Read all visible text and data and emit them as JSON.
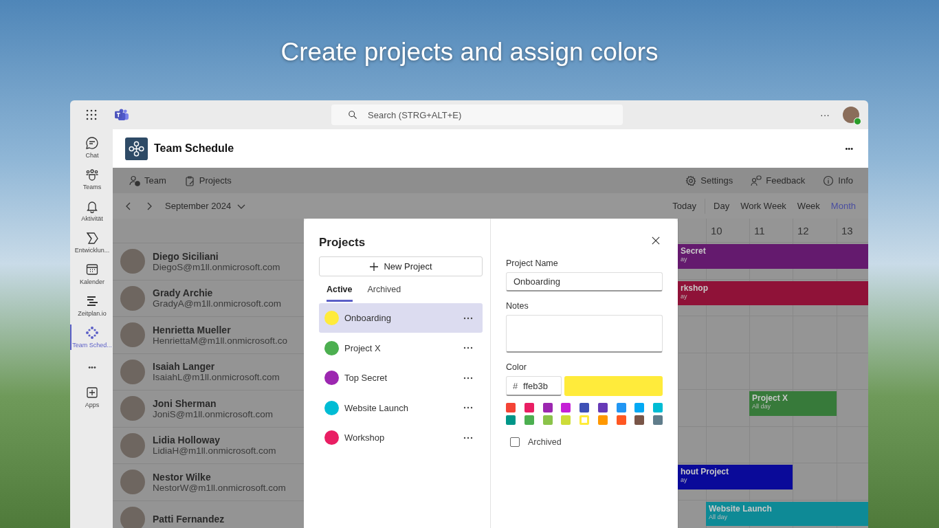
{
  "headline": "Create projects and assign colors",
  "top_bar": {
    "search": {
      "placeholder": "Search (STRG+ALT+E)"
    },
    "more": "···"
  },
  "rail": [
    {
      "label": "Chat",
      "kind": "chat",
      "selected": false
    },
    {
      "label": "Teams",
      "kind": "teams",
      "selected": false
    },
    {
      "label": "Aktivität",
      "kind": "bell",
      "selected": false
    },
    {
      "label": "Entwicklun...",
      "kind": "dev",
      "selected": false
    },
    {
      "label": "Kalender",
      "kind": "calendar",
      "selected": false
    },
    {
      "label": "Zeitplan.io",
      "kind": "lines",
      "selected": false
    },
    {
      "label": "Team Sched...",
      "kind": "app",
      "selected": true
    },
    {
      "label": "•••",
      "kind": "more",
      "selected": false
    },
    {
      "label": "Apps",
      "kind": "apps",
      "selected": false
    }
  ],
  "app_header": {
    "title": "Team Schedule",
    "more": "•••"
  },
  "toolbar": {
    "left": [
      {
        "label": "Team",
        "kind": "team"
      },
      {
        "label": "Projects",
        "kind": "projects"
      }
    ],
    "right": [
      {
        "label": "Settings",
        "kind": "settings"
      },
      {
        "label": "Feedback",
        "kind": "feedback"
      },
      {
        "label": "Info",
        "kind": "info"
      }
    ]
  },
  "nav": {
    "month": "September 2024",
    "today": "Today",
    "views": [
      {
        "label": "Day",
        "selected": false
      },
      {
        "label": "Work Week",
        "selected": false
      },
      {
        "label": "Week",
        "selected": false
      },
      {
        "label": "Month",
        "selected": true
      }
    ]
  },
  "people": [
    {
      "name": "Diego Siciliani",
      "email": "DiegoS@m1ll.onmicrosoft.com"
    },
    {
      "name": "Grady Archie",
      "email": "GradyA@m1ll.onmicrosoft.com"
    },
    {
      "name": "Henrietta Mueller",
      "email": "HenriettaM@m1ll.onmicrosoft.co"
    },
    {
      "name": "Isaiah Langer",
      "email": "IsaiahL@m1ll.onmicrosoft.com"
    },
    {
      "name": "Joni Sherman",
      "email": "JoniS@m1ll.onmicrosoft.com"
    },
    {
      "name": "Lidia Holloway",
      "email": "LidiaH@m1ll.onmicrosoft.com"
    },
    {
      "name": "Nestor Wilke",
      "email": "NestorW@m1ll.onmicrosoft.com"
    },
    {
      "name": "Patti Fernandez"
    }
  ],
  "calendar": {
    "days": [
      "10",
      "11",
      "12",
      "13"
    ],
    "rows": [
      {
        "event": {
          "title": "Secret",
          "subtitle": "ay",
          "color": "#641a6e"
        }
      },
      {
        "event": {
          "title": "rkshop",
          "subtitle": "ay",
          "color": "#8f1238"
        }
      },
      {},
      {},
      {
        "event": {
          "title": "Project X",
          "subtitle": "All day",
          "color": "#377a3a"
        }
      },
      {},
      {
        "event": {
          "title": "hout Project",
          "subtitle": "ay",
          "color": "#0a0a99"
        }
      },
      {
        "event": {
          "title": "Website Launch",
          "subtitle": "All day",
          "color": "#0e8a96"
        }
      }
    ]
  },
  "dialog": {
    "title": "Projects",
    "new_button": "New Project",
    "tabs": [
      {
        "label": "Active",
        "selected": true
      },
      {
        "label": "Archived",
        "selected": false
      }
    ],
    "projects": [
      {
        "name": "Onboarding",
        "color": "#ffeb3b",
        "selected": true
      },
      {
        "name": "Project X",
        "color": "#4caf50",
        "selected": false
      },
      {
        "name": "Top Secret",
        "color": "#9c27b0",
        "selected": false
      },
      {
        "name": "Website Launch",
        "color": "#00bcd4",
        "selected": false
      },
      {
        "name": "Workshop",
        "color": "#e91e63",
        "selected": false
      }
    ],
    "name_label": "Project Name",
    "name_value": "Onboarding",
    "notes_label": "Notes",
    "color_label": "Color",
    "hex_prefix": "#",
    "hex_value": "ffeb3b",
    "palette": [
      {
        "color": "#f44336",
        "selected": false
      },
      {
        "color": "#e91e63",
        "selected": false
      },
      {
        "color": "#9c27b0",
        "selected": false
      },
      {
        "color": "#c51fd6",
        "selected": false
      },
      {
        "color": "#3f51b5",
        "selected": false
      },
      {
        "color": "#673ab7",
        "selected": false
      },
      {
        "color": "#2196f3",
        "selected": false
      },
      {
        "color": "#03a9f4",
        "selected": false
      },
      {
        "color": "#00bcd4",
        "selected": false
      },
      {
        "color": "#009688",
        "selected": false
      },
      {
        "color": "#4caf50",
        "selected": false
      },
      {
        "color": "#8bc34a",
        "selected": false
      },
      {
        "color": "#cddc39",
        "selected": false
      },
      {
        "color": "#ffeb3b",
        "selected": true
      },
      {
        "color": "#ff9800",
        "selected": false
      },
      {
        "color": "#ff5722",
        "selected": false
      },
      {
        "color": "#795548",
        "selected": false
      },
      {
        "color": "#607d8b",
        "selected": false
      }
    ],
    "archived": {
      "label": "Archived",
      "checked": false
    }
  }
}
